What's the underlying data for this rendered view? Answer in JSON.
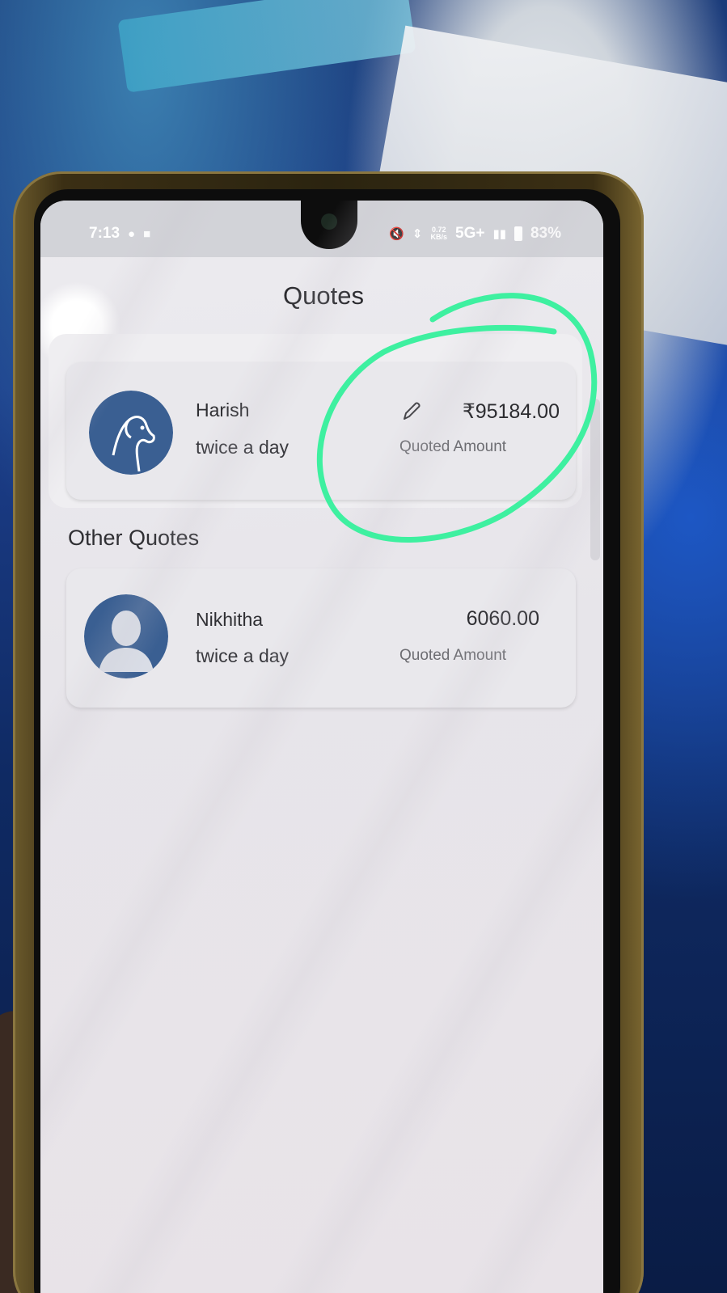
{
  "status_bar": {
    "time": "7:13",
    "network": "5G+",
    "speed_value": "0.72",
    "speed_unit": "KB/s",
    "battery": "83%"
  },
  "page": {
    "title": "Quotes"
  },
  "my_quote": {
    "name": "Harish",
    "frequency": "twice a day",
    "amount": "₹95184.00",
    "amount_label": "Quoted Amount",
    "avatar_icon": "dog-avatar-icon",
    "edit_icon": "pencil-icon"
  },
  "other_quotes": {
    "section_title": "Other Quotes",
    "items": [
      {
        "name": "Nikhitha",
        "frequency": "twice a day",
        "amount": "6060.00",
        "amount_label": "Quoted Amount",
        "avatar_icon": "person-silhouette-icon"
      }
    ]
  },
  "colors": {
    "annotation_stroke": "#3ef0a0",
    "avatar_blue": "#3a5f92",
    "card_bg": "#e9e8ec"
  }
}
